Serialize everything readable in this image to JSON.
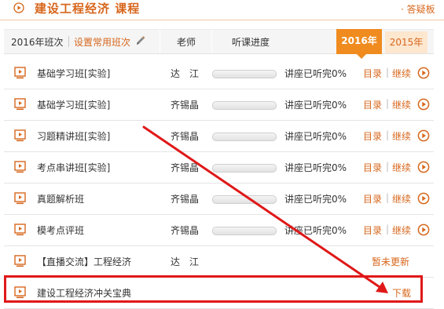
{
  "header": {
    "title": "建设工程经济  课程",
    "right_link": "· 答疑板"
  },
  "toolbar": {
    "year_class": "2016年班次",
    "set_common": "设置常用班次",
    "col_teacher": "老师",
    "col_progress": "听课进度",
    "tabs": [
      {
        "label": "2016年",
        "active": true
      },
      {
        "label": "2015年",
        "active": false
      }
    ]
  },
  "rows": [
    {
      "name": "基础学习班[实验]",
      "teacher": "达　江",
      "progress": "讲座已听完0%",
      "progress_value": 0,
      "catalog": "目录",
      "continue": "继续"
    },
    {
      "name": "基础学习班[实验]",
      "teacher": "齐锡晶",
      "progress": "讲座已听完0%",
      "progress_value": 0,
      "catalog": "目录",
      "continue": "继续"
    },
    {
      "name": "习题精讲班[实验]",
      "teacher": "齐锡晶",
      "progress": "讲座已听完0%",
      "progress_value": 0,
      "catalog": "目录",
      "continue": "继续"
    },
    {
      "name": "考点串讲班[实验]",
      "teacher": "齐锡晶",
      "progress": "讲座已听完0%",
      "progress_value": 0,
      "catalog": "目录",
      "continue": "继续"
    },
    {
      "name": "真题解析班",
      "teacher": "齐锡晶",
      "progress": "讲座已听完0%",
      "progress_value": 0,
      "catalog": "目录",
      "continue": "继续"
    },
    {
      "name": "模考点评班",
      "teacher": "齐锡晶",
      "progress": "讲座已听完0%",
      "progress_value": 0,
      "catalog": "目录",
      "continue": "继续"
    },
    {
      "name": "【直播交流】工程经济",
      "teacher": "达　江",
      "status": "暂未更新"
    },
    {
      "name": "建设工程经济冲关宝典",
      "download": "下载"
    }
  ],
  "colors": {
    "accent": "#d7671d",
    "tab_active": "#f08b1f",
    "highlight": "#e01818"
  }
}
